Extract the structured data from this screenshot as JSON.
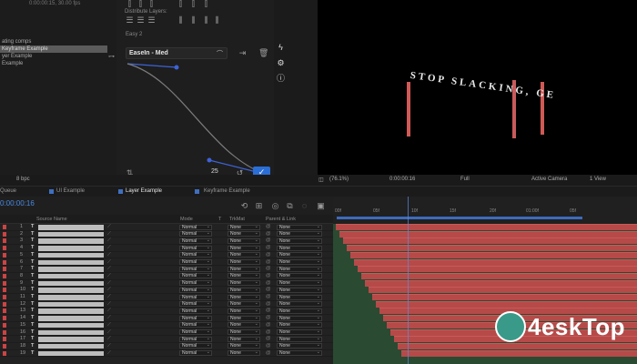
{
  "project": {
    "fps_text": "0:00:00:15, 30.00 fps",
    "items": [
      "ating comps",
      "Keyframe Example",
      "yer Example",
      "Example"
    ],
    "selected_index": 1
  },
  "align": {
    "distribute_label": "Distribute Layers:",
    "panel_label": "Easy 2"
  },
  "easing": {
    "preset": "EaseIn - Med",
    "value": "25"
  },
  "viewer": {
    "text": "STOP SLACKING, GE"
  },
  "viewer_footer": {
    "bpc": "8 bpc",
    "zoom": "(76.1%)",
    "timecode": "0:00:00:16",
    "resolution": "Full",
    "camera": "Active Camera",
    "views": "1 View"
  },
  "tabs": [
    {
      "label": "Queue",
      "active": false
    },
    {
      "label": "UI Example",
      "active": false
    },
    {
      "label": "Layer Example",
      "active": true
    },
    {
      "label": "Keyframe Example",
      "active": false
    }
  ],
  "time": {
    "timecode": "0:00:00:16"
  },
  "columns": {
    "source_name": "Source Name",
    "mode": "Mode",
    "t": "T",
    "trkmat": "TrkMat",
    "parent": "Parent & Link"
  },
  "ruler_ticks": [
    "00f",
    "05f",
    "10f",
    "15f",
    "20f",
    "01:00f",
    "05f"
  ],
  "layers": [
    {
      "num": "1",
      "mode": "Normal",
      "trkmat": "None",
      "parent": "None"
    },
    {
      "num": "2",
      "mode": "Normal",
      "trkmat": "None",
      "parent": "None"
    },
    {
      "num": "3",
      "mode": "Normal",
      "trkmat": "None",
      "parent": "None"
    },
    {
      "num": "4",
      "mode": "Normal",
      "trkmat": "None",
      "parent": "None"
    },
    {
      "num": "5",
      "mode": "Normal",
      "trkmat": "None",
      "parent": "None"
    },
    {
      "num": "6",
      "mode": "Normal",
      "trkmat": "None",
      "parent": "None"
    },
    {
      "num": "7",
      "mode": "Normal",
      "trkmat": "None",
      "parent": "None"
    },
    {
      "num": "8",
      "mode": "Normal",
      "trkmat": "None",
      "parent": "None"
    },
    {
      "num": "9",
      "mode": "Normal",
      "trkmat": "None",
      "parent": "None"
    },
    {
      "num": "10",
      "mode": "Normal",
      "trkmat": "None",
      "parent": "None"
    },
    {
      "num": "11",
      "mode": "Normal",
      "trkmat": "None",
      "parent": "None"
    },
    {
      "num": "12",
      "mode": "Normal",
      "trkmat": "None",
      "parent": "None"
    },
    {
      "num": "13",
      "mode": "Normal",
      "trkmat": "None",
      "parent": "None"
    },
    {
      "num": "14",
      "mode": "Normal",
      "trkmat": "None",
      "parent": "None"
    },
    {
      "num": "15",
      "mode": "Normal",
      "trkmat": "None",
      "parent": "None"
    },
    {
      "num": "16",
      "mode": "Normal",
      "trkmat": "None",
      "parent": "None"
    },
    {
      "num": "17",
      "mode": "Normal",
      "trkmat": "None",
      "parent": "None"
    },
    {
      "num": "18",
      "mode": "Normal",
      "trkmat": "None",
      "parent": "None"
    },
    {
      "num": "19",
      "mode": "Normal",
      "trkmat": "None",
      "parent": "None"
    }
  ],
  "watermark": "4eskTop",
  "colors": {
    "accent": "#2b6fd6",
    "layer_bar": "#b54a49",
    "layer_label": "#c44444"
  }
}
